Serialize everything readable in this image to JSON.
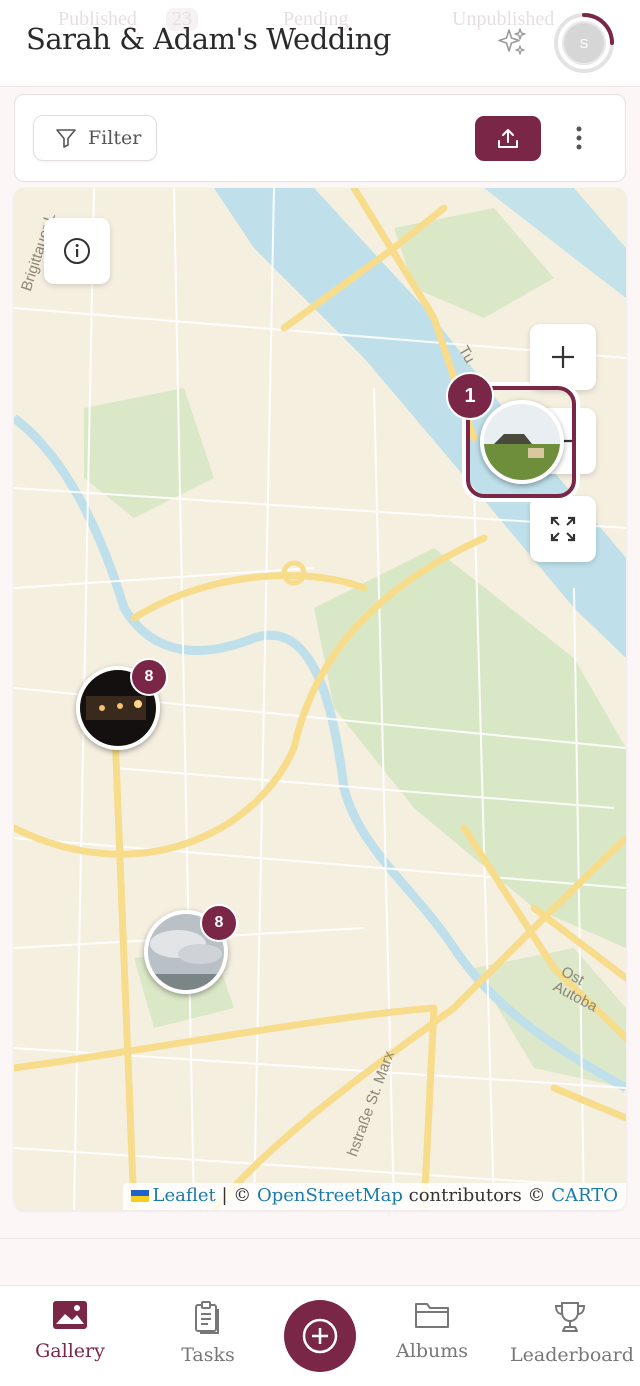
{
  "header": {
    "title": "Sarah & Adam's Wedding",
    "avatar_initial": "S",
    "ghost_tabs": [
      {
        "label": "Published",
        "count": "23"
      },
      {
        "label": "Pending"
      },
      {
        "label": "Unpublished"
      }
    ]
  },
  "toolbar": {
    "filter_label": "Filter"
  },
  "map": {
    "labels": {
      "brigitta": "Brigittauer L",
      "ost_autobahn": "Ost Autoba",
      "strasse": "hstraße St. Marx",
      "tu": "Tu"
    },
    "clusters": [
      {
        "count": "1",
        "photo": "garden"
      },
      {
        "count": "8",
        "photo": "night-bar"
      },
      {
        "count": "8",
        "photo": "cloudy-sky"
      }
    ],
    "attribution": {
      "leaflet": "Leaflet",
      "sep": " | © ",
      "osm": "OpenStreetMap",
      "contributors": " contributors © ",
      "carto": "CARTO"
    }
  },
  "nav": {
    "items": [
      {
        "label": "Gallery",
        "icon": "image-icon",
        "active": true
      },
      {
        "label": "Tasks",
        "icon": "clipboard-icon"
      },
      {
        "label": "Albums",
        "icon": "folder-icon"
      },
      {
        "label": "Leaderboard",
        "icon": "trophy-icon"
      }
    ]
  },
  "colors": {
    "accent": "#7a2647",
    "water": "#bfe0ea",
    "park": "#d8e8c6",
    "road": "#f7dc8c",
    "land": "#f5efe0"
  }
}
